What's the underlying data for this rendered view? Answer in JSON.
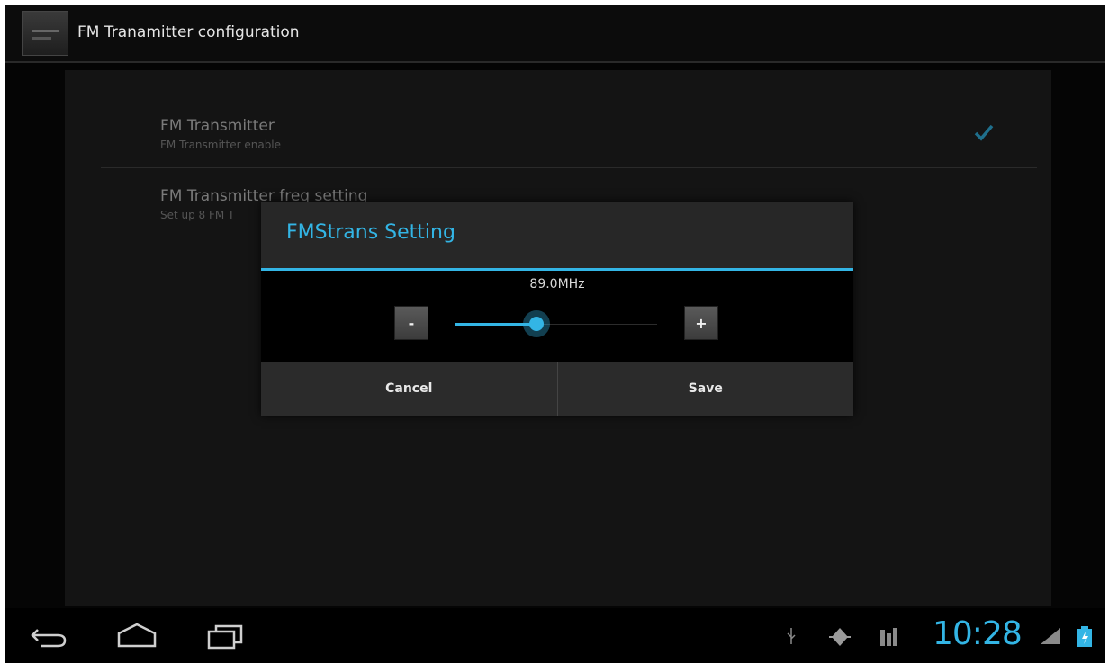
{
  "action_bar": {
    "title": "FM Tranamitter configuration",
    "icon": "app-settings-icon"
  },
  "preferences": [
    {
      "title": "FM Transmitter",
      "summary": "FM Transmitter enable",
      "checked": true
    },
    {
      "title": "FM Transmitter freq setting",
      "summary": "Set up 8 FM T"
    }
  ],
  "dialog": {
    "title": "FMStrans Setting",
    "frequency": "89.0MHz",
    "minus_label": "-",
    "plus_label": "+",
    "slider_fraction": 0.4,
    "cancel_label": "Cancel",
    "save_label": "Save"
  },
  "status_bar": {
    "time": "10:28",
    "icons": [
      "usb-icon",
      "debug-icon",
      "signal-icon",
      "network-icon",
      "battery-icon"
    ]
  },
  "colors": {
    "accent": "#33b5e5",
    "background": "#050505"
  }
}
